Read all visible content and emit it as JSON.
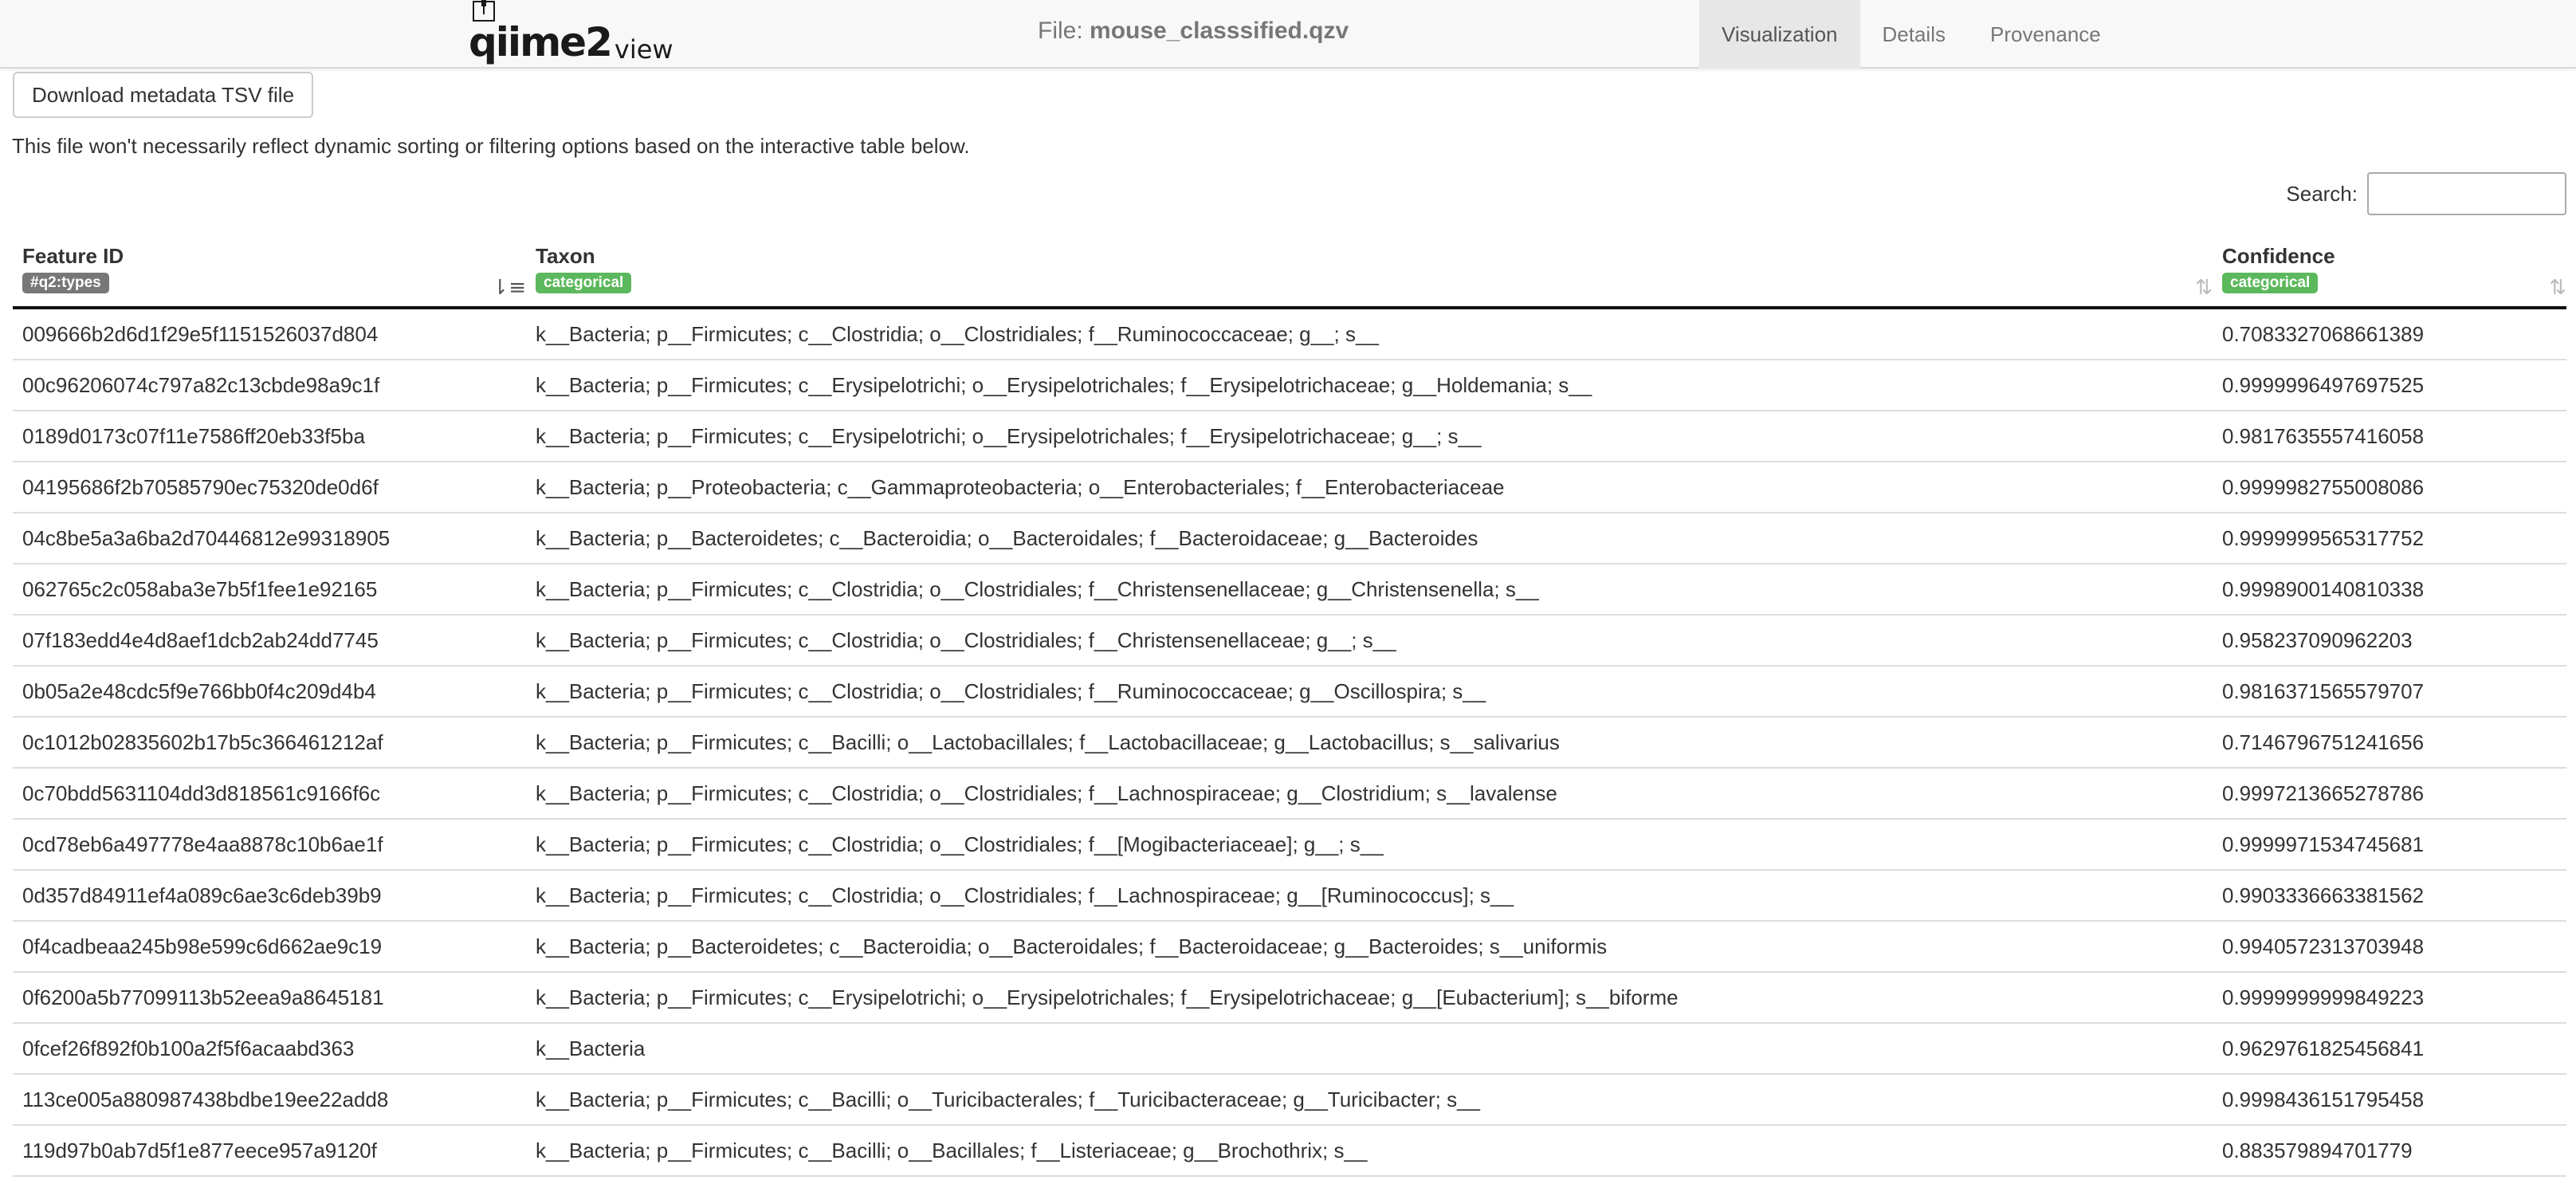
{
  "navbar": {
    "logo_main": "qiime2",
    "logo_view": "view",
    "file_prefix": "File: ",
    "file_name": "mouse_classsified.qzv",
    "tabs": [
      {
        "label": "Visualization",
        "active": true
      },
      {
        "label": "Details",
        "active": false
      },
      {
        "label": "Provenance",
        "active": false
      }
    ]
  },
  "download_button": "Download metadata TSV file",
  "note": "This file won't necessarily reflect dynamic sorting or filtering options based on the interactive table below.",
  "search": {
    "label": "Search:",
    "value": ""
  },
  "table": {
    "columns": [
      {
        "title": "Feature ID",
        "badge": "#q2:types",
        "badge_color": "#777777",
        "sort": "ascending"
      },
      {
        "title": "Taxon",
        "badge": "categorical",
        "badge_color": "#5cb85c",
        "sort": "none"
      },
      {
        "title": "Confidence",
        "badge": "categorical",
        "badge_color": "#5cb85c",
        "sort": "none"
      }
    ],
    "rows": [
      {
        "id": "009666b2d6d1f29e5f1151526037d804",
        "taxon": "k__Bacteria; p__Firmicutes; c__Clostridia; o__Clostridiales; f__Ruminococcaceae; g__; s__",
        "confidence": "0.7083327068661389"
      },
      {
        "id": "00c96206074c797a82c13cbde98a9c1f",
        "taxon": "k__Bacteria; p__Firmicutes; c__Erysipelotrichi; o__Erysipelotrichales; f__Erysipelotrichaceae; g__Holdemania; s__",
        "confidence": "0.9999996497697525"
      },
      {
        "id": "0189d0173c07f11e7586ff20eb33f5ba",
        "taxon": "k__Bacteria; p__Firmicutes; c__Erysipelotrichi; o__Erysipelotrichales; f__Erysipelotrichaceae; g__; s__",
        "confidence": "0.9817635557416058"
      },
      {
        "id": "04195686f2b70585790ec75320de0d6f",
        "taxon": "k__Bacteria; p__Proteobacteria; c__Gammaproteobacteria; o__Enterobacteriales; f__Enterobacteriaceae",
        "confidence": "0.9999982755008086"
      },
      {
        "id": "04c8be5a3a6ba2d70446812e99318905",
        "taxon": "k__Bacteria; p__Bacteroidetes; c__Bacteroidia; o__Bacteroidales; f__Bacteroidaceae; g__Bacteroides",
        "confidence": "0.9999999565317752"
      },
      {
        "id": "062765c2c058aba3e7b5f1fee1e92165",
        "taxon": "k__Bacteria; p__Firmicutes; c__Clostridia; o__Clostridiales; f__Christensenellaceae; g__Christensenella; s__",
        "confidence": "0.9998900140810338"
      },
      {
        "id": "07f183edd4e4d8aef1dcb2ab24dd7745",
        "taxon": "k__Bacteria; p__Firmicutes; c__Clostridia; o__Clostridiales; f__Christensenellaceae; g__; s__",
        "confidence": "0.958237090962203"
      },
      {
        "id": "0b05a2e48cdc5f9e766bb0f4c209d4b4",
        "taxon": "k__Bacteria; p__Firmicutes; c__Clostridia; o__Clostridiales; f__Ruminococcaceae; g__Oscillospira; s__",
        "confidence": "0.9816371565579707"
      },
      {
        "id": "0c1012b02835602b17b5c366461212af",
        "taxon": "k__Bacteria; p__Firmicutes; c__Bacilli; o__Lactobacillales; f__Lactobacillaceae; g__Lactobacillus; s__salivarius",
        "confidence": "0.7146796751241656"
      },
      {
        "id": "0c70bdd5631104dd3d818561c9166f6c",
        "taxon": "k__Bacteria; p__Firmicutes; c__Clostridia; o__Clostridiales; f__Lachnospiraceae; g__Clostridium; s__lavalense",
        "confidence": "0.9997213665278786"
      },
      {
        "id": "0cd78eb6a497778e4aa8878c10b6ae1f",
        "taxon": "k__Bacteria; p__Firmicutes; c__Clostridia; o__Clostridiales; f__[Mogibacteriaceae]; g__; s__",
        "confidence": "0.9999971534745681"
      },
      {
        "id": "0d357d84911ef4a089c6ae3c6deb39b9",
        "taxon": "k__Bacteria; p__Firmicutes; c__Clostridia; o__Clostridiales; f__Lachnospiraceae; g__[Ruminococcus]; s__",
        "confidence": "0.9903336663381562"
      },
      {
        "id": "0f4cadbeaa245b98e599c6d662ae9c19",
        "taxon": "k__Bacteria; p__Bacteroidetes; c__Bacteroidia; o__Bacteroidales; f__Bacteroidaceae; g__Bacteroides; s__uniformis",
        "confidence": "0.9940572313703948"
      },
      {
        "id": "0f6200a5b77099113b52eea9a8645181",
        "taxon": "k__Bacteria; p__Firmicutes; c__Erysipelotrichi; o__Erysipelotrichales; f__Erysipelotrichaceae; g__[Eubacterium]; s__biforme",
        "confidence": "0.9999999999849223"
      },
      {
        "id": "0fcef26f892f0b100a2f5f6acaabd363",
        "taxon": "k__Bacteria",
        "confidence": "0.9629761825456841"
      },
      {
        "id": "113ce005a880987438bdbe19ee22add8",
        "taxon": "k__Bacteria; p__Firmicutes; c__Bacilli; o__Turicibacterales; f__Turicibacteraceae; g__Turicibacter; s__",
        "confidence": "0.9998436151795458"
      },
      {
        "id": "119d97b0ab7d5f1e877eece957a9120f",
        "taxon": "k__Bacteria; p__Firmicutes; c__Bacilli; o__Bacillales; f__Listeriaceae; g__Brochothrix; s__",
        "confidence": "0.883579894701779"
      }
    ]
  }
}
